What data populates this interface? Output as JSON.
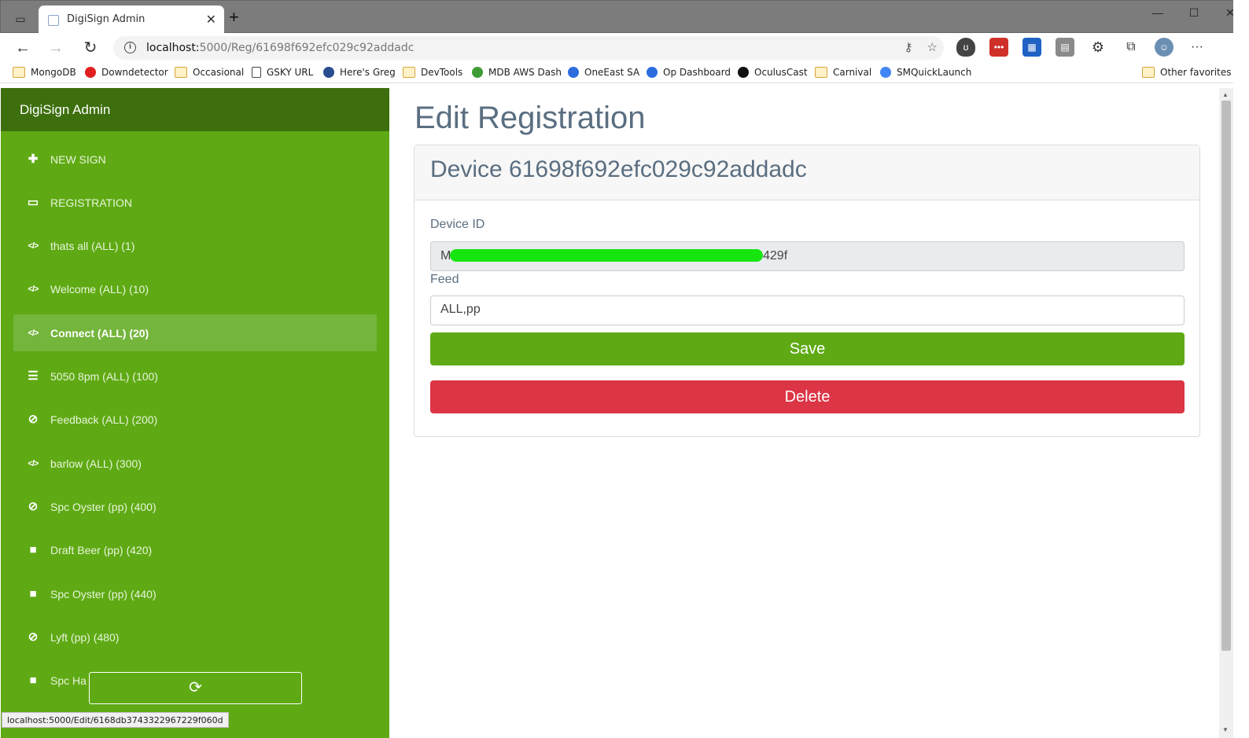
{
  "browser": {
    "tab_title": "DigiSign Admin",
    "url_host": "localhost:",
    "url_path": "5000/Reg/61698f692efc029c92addadc",
    "bookmarks": [
      {
        "label": "MongoDB",
        "type": "folder"
      },
      {
        "label": "Downdetector",
        "type": "site",
        "color": "#e02020"
      },
      {
        "label": "Occasional",
        "type": "folder"
      },
      {
        "label": "GSKY URL",
        "type": "page"
      },
      {
        "label": "Here's Greg",
        "type": "site",
        "color": "#2a4d8f"
      },
      {
        "label": "DevTools",
        "type": "folder"
      },
      {
        "label": "MDB AWS Dash",
        "type": "site",
        "color": "#3f9c35"
      },
      {
        "label": "OneEast SA",
        "type": "site",
        "color": "#2d6cdf"
      },
      {
        "label": "Op Dashboard",
        "type": "site",
        "color": "#2d6cdf"
      },
      {
        "label": "OculusCast",
        "type": "site",
        "color": "#111111"
      },
      {
        "label": "Carnival",
        "type": "folder"
      },
      {
        "label": "SMQuickLaunch",
        "type": "site",
        "color": "#4285f4"
      }
    ],
    "other_favorites": "Other favorites",
    "status_url": "localhost:5000/Edit/6168db3743322967229f060d"
  },
  "sidebar": {
    "brand": "DigiSign Admin",
    "items": [
      {
        "label": "NEW SIGN",
        "icon": "plus-icon"
      },
      {
        "label": "REGISTRATION",
        "icon": "monitor-icon"
      },
      {
        "label": "thats all (ALL) (1)",
        "icon": "code-icon"
      },
      {
        "label": "Welcome (ALL) (10)",
        "icon": "code-icon"
      },
      {
        "label": "Connect (ALL) (20)",
        "icon": "code-icon",
        "active": true
      },
      {
        "label": "5050 8pm (ALL) (100)",
        "icon": "align-left-icon"
      },
      {
        "label": "Feedback (ALL) (200)",
        "icon": "ban-icon"
      },
      {
        "label": "barlow (ALL) (300)",
        "icon": "code-icon"
      },
      {
        "label": "Spc Oyster (pp) (400)",
        "icon": "ban-icon"
      },
      {
        "label": "Draft Beer (pp) (420)",
        "icon": "video-icon"
      },
      {
        "label": "Spc Oyster (pp) (440)",
        "icon": "video-icon"
      },
      {
        "label": "Lyft (pp) (480)",
        "icon": "ban-icon"
      },
      {
        "label": "Spc Ha",
        "icon": "video-icon"
      }
    ]
  },
  "main": {
    "title": "Edit Registration",
    "card_header": "Device 61698f692efc029c92addadc",
    "device_id_label": "Device ID",
    "device_id_prefix": "M",
    "device_id_suffix": "429f",
    "feed_label": "Feed",
    "feed_value": "ALL,pp",
    "save_label": "Save",
    "delete_label": "Delete"
  },
  "colors": {
    "sidebar": "#5faa14",
    "brand_bar": "#3d6f0e",
    "save": "#5faa14",
    "delete": "#dc3545"
  }
}
